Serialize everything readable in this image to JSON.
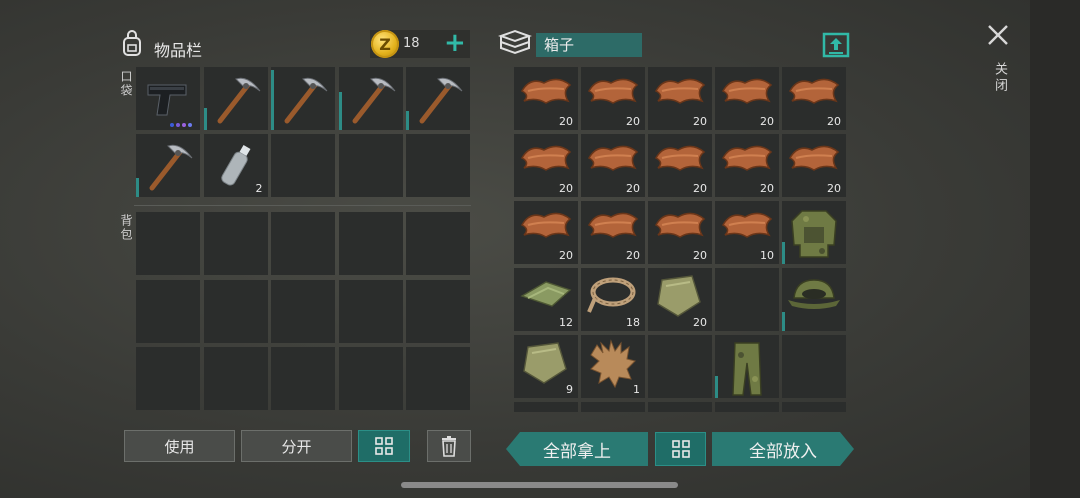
{
  "inventory": {
    "title": "物品栏",
    "coins": "18",
    "coin_symbol": "Z",
    "pocket_label": "口袋",
    "backpack_label": "背包",
    "pocket_slots": [
      {
        "item": "pistol-icon",
        "count": "",
        "durability": 0,
        "quality": true
      },
      {
        "item": "pickaxe-icon",
        "count": "",
        "durability": 0.35
      },
      {
        "item": "pickaxe-icon",
        "count": "",
        "durability": 0.95
      },
      {
        "item": "pickaxe-icon",
        "count": "",
        "durability": 0.6
      },
      {
        "item": "pickaxe-icon",
        "count": "",
        "durability": 0.3
      },
      {
        "item": "pickaxe-icon",
        "count": "",
        "durability": 0.3
      },
      {
        "item": "water-bottle-icon",
        "count": "2",
        "durability": 0
      },
      {
        "item": "",
        "count": ""
      },
      {
        "item": "",
        "count": ""
      },
      {
        "item": "",
        "count": ""
      }
    ],
    "quality_colors": [
      "#3b5bd8",
      "#7a5bd8",
      "#9a62e0",
      "#6c7cf0"
    ]
  },
  "box": {
    "title": "箱子",
    "slots": [
      {
        "item": "leather-icon",
        "count": "20"
      },
      {
        "item": "leather-icon",
        "count": "20"
      },
      {
        "item": "leather-icon",
        "count": "20"
      },
      {
        "item": "leather-icon",
        "count": "20"
      },
      {
        "item": "leather-icon",
        "count": "20"
      },
      {
        "item": "leather-icon",
        "count": "20"
      },
      {
        "item": "leather-icon",
        "count": "20"
      },
      {
        "item": "leather-icon",
        "count": "20"
      },
      {
        "item": "leather-icon",
        "count": "20"
      },
      {
        "item": "leather-icon",
        "count": "20"
      },
      {
        "item": "leather-icon",
        "count": "20"
      },
      {
        "item": "leather-icon",
        "count": "20"
      },
      {
        "item": "leather-icon",
        "count": "20"
      },
      {
        "item": "leather-icon",
        "count": "10"
      },
      {
        "item": "camo-jacket-icon",
        "count": "",
        "durability": 0.35
      },
      {
        "item": "cloth-icon",
        "count": "12"
      },
      {
        "item": "rope-icon",
        "count": "18"
      },
      {
        "item": "cloth-scrap-icon",
        "count": "20"
      },
      {
        "item": "",
        "count": ""
      },
      {
        "item": "camo-hat-icon",
        "count": "",
        "durability": 0.3
      },
      {
        "item": "cloth-scrap-icon",
        "count": "9"
      },
      {
        "item": "fur-icon",
        "count": "1"
      },
      {
        "item": "",
        "count": ""
      },
      {
        "item": "camo-pants-icon",
        "count": "",
        "durability": 0.35
      },
      {
        "item": "",
        "count": ""
      }
    ]
  },
  "buttons": {
    "use": "使用",
    "split": "分开",
    "take_all": "全部拿上",
    "put_all": "全部放入",
    "close": "关闭"
  },
  "colors": {
    "accent": "#2b8f87",
    "slot": "#2b2d2c",
    "leather": "#b3643a"
  }
}
